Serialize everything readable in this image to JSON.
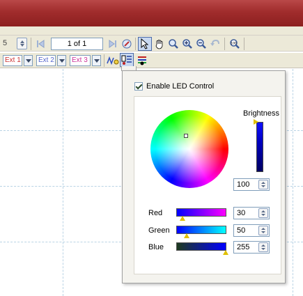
{
  "toolbar": {
    "left_fragment": "5",
    "page_value": "1 of 1",
    "ext": [
      {
        "label": "Ext 1",
        "color": "#cc3333"
      },
      {
        "label": "Ext 2",
        "color": "#5566cc"
      },
      {
        "label": "Ext 3",
        "color": "#cc3399"
      }
    ]
  },
  "led_panel": {
    "enable_label": "Enable LED Control",
    "enabled": true,
    "brightness": {
      "label": "Brightness",
      "value": "100",
      "level": 100
    },
    "channels": [
      {
        "label": "Red",
        "value": "30",
        "level": 30,
        "gradient": [
          "#0000ff",
          "#ff00ff"
        ]
      },
      {
        "label": "Green",
        "value": "50",
        "level": 50,
        "gradient": [
          "#0000ff",
          "#00ffff"
        ]
      },
      {
        "label": "Blue",
        "value": "255",
        "level": 255,
        "gradient": [
          "#1e3a1e",
          "#0000ff"
        ]
      }
    ]
  },
  "colors": {
    "accent": "#316ac5",
    "marker": "#e0c000"
  }
}
